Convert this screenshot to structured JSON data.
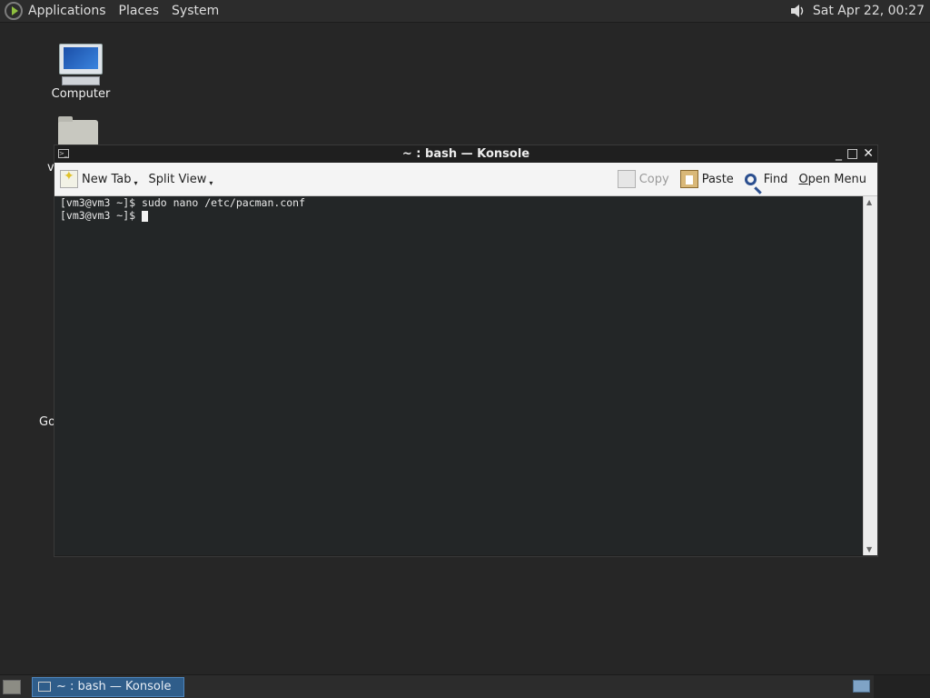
{
  "top_panel": {
    "menus": [
      "Applications",
      "Places",
      "System"
    ],
    "clock": "Sat Apr 22, 00:27"
  },
  "desktop": {
    "computer_label": "Computer",
    "partial_label_v": "v",
    "partial_label_go": "Go"
  },
  "window": {
    "title": "~ : bash — Konsole",
    "toolbar": {
      "new_tab": "New Tab",
      "split_view": "Split View",
      "copy": "Copy",
      "paste": "Paste",
      "find": "Find",
      "open_menu": "Open Menu"
    },
    "terminal_lines": [
      "[vm3@vm3 ~]$ sudo nano /etc/pacman.conf",
      "[vm3@vm3 ~]$ "
    ]
  },
  "taskbar": {
    "task_label": "~ : bash — Konsole"
  }
}
